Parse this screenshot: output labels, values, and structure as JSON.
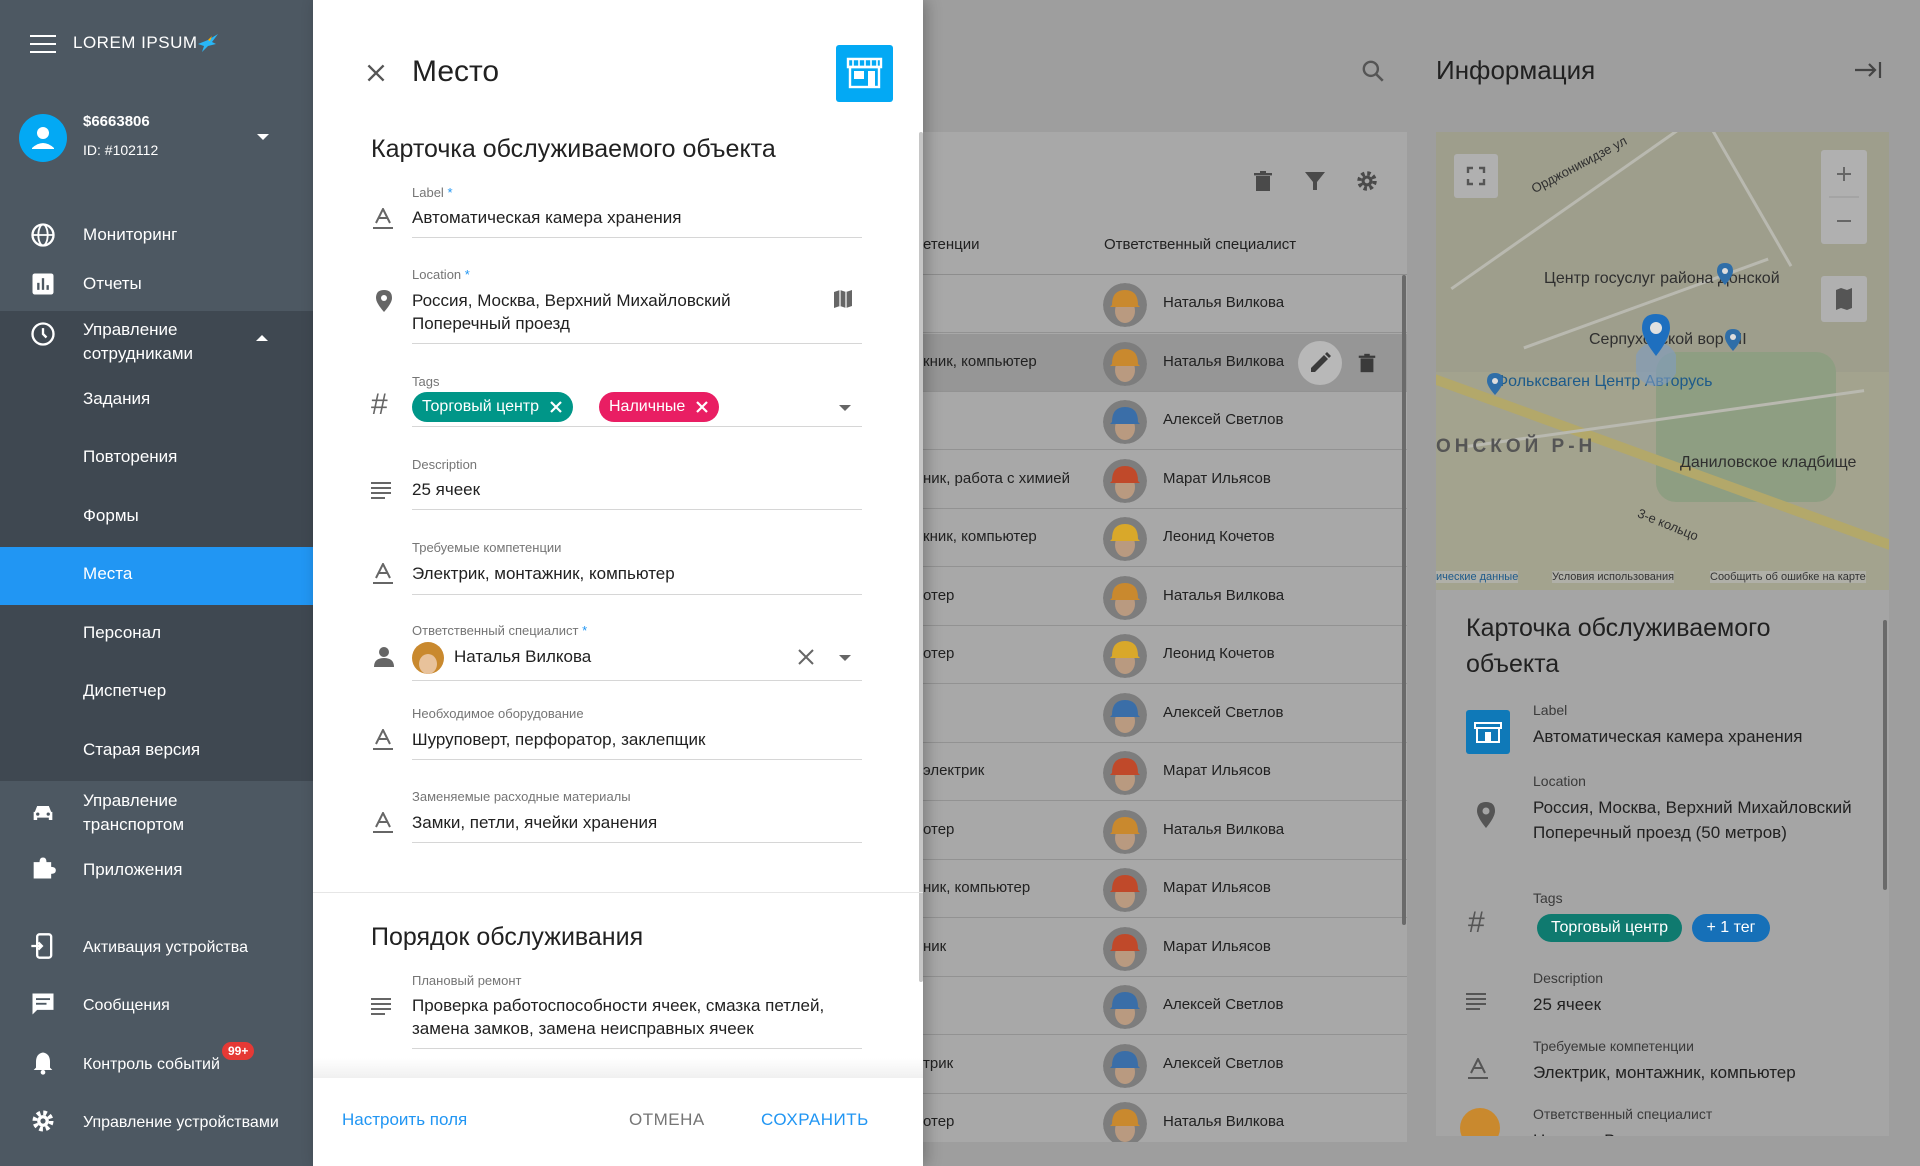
{
  "app": {
    "logo_text": "LOREM IPSUM",
    "account": {
      "name": "$6663806",
      "id": "ID: #102112"
    }
  },
  "sidebar": {
    "items": [
      {
        "label": "Мониторинг",
        "icon": "globe-icon"
      },
      {
        "label": "Отчеты",
        "icon": "chart-icon"
      },
      {
        "label": "Управление сотрудниками",
        "icon": "clock-icon"
      },
      {
        "label": "Управление транспортом",
        "icon": "car-icon"
      },
      {
        "label": "Приложения",
        "icon": "puzzle-icon"
      },
      {
        "label": "Активация устройства",
        "icon": "phone-add-icon"
      },
      {
        "label": "Сообщения",
        "icon": "message-icon"
      },
      {
        "label": "Контроль событий",
        "icon": "bell-icon",
        "badge": "99+"
      },
      {
        "label": "Управление устройствами",
        "icon": "gear-icon"
      }
    ],
    "sub_items": [
      "Задания",
      "Повторения",
      "Формы",
      "Места",
      "Персонал",
      "Диспетчер",
      "Старая версия"
    ],
    "active_sub": "Места"
  },
  "dialog": {
    "title": "Место",
    "section1_title": "Карточка обслуживаемого объекта",
    "fields": {
      "label": {
        "label": "Label",
        "value": "Автоматическая камера хранения"
      },
      "location": {
        "label": "Location",
        "value": "Россия, Москва, Верхний Михайловский Поперечный проезд"
      },
      "tags": {
        "label": "Tags",
        "chips": [
          "Торговый центр",
          "Наличные"
        ]
      },
      "description": {
        "label": "Description",
        "value": "25 ячеек"
      },
      "competencies": {
        "label": "Требуемые компетенции",
        "value": "Электрик, монтажник, компьютер"
      },
      "specialist": {
        "label": "Ответственный специалист",
        "value": "Наталья Вилкова"
      },
      "equipment": {
        "label": "Необходимое оборудование",
        "value": "Шуруповерт, перфоратор, заклепщик"
      },
      "materials": {
        "label": "Заменяемые расходные материалы",
        "value": "Замки, петли, ячейки хранения"
      }
    },
    "section2_title": "Порядок обслуживания",
    "repair": {
      "label": "Плановый ремонт",
      "value": "Проверка работоспособности ячеек, смазка петлей, замена замков, замена неисправных ячеек"
    },
    "footer": {
      "configure": "Настроить поля",
      "cancel": "ОТМЕНА",
      "save": "СОХРАНИТЬ"
    },
    "colors": {
      "accent": "#2196f3",
      "chip_teal": "#009688",
      "chip_pink": "#e91e63",
      "store_tile": "#03a9f4"
    }
  },
  "table": {
    "col_competencies": "етенции",
    "col_specialist": "Ответственный специалист",
    "rows": [
      {
        "comp": "",
        "name": "Наталья Вилкова",
        "helmet": "#c9892e"
      },
      {
        "comp": "кник, компьютер",
        "name": "Наталья Вилкова",
        "helmet": "#c9892e"
      },
      {
        "comp": "",
        "name": "Алексей Светлов",
        "helmet": "#3a6ea8"
      },
      {
        "comp": "ник, работа с химией",
        "name": "Марат Ильясов",
        "helmet": "#c0492a"
      },
      {
        "comp": "кник, компьютер",
        "name": "Леонид Кочетов",
        "helmet": "#d9a82a"
      },
      {
        "comp": "отер",
        "name": "Наталья Вилкова",
        "helmet": "#c9892e"
      },
      {
        "comp": "отер",
        "name": "Леонид Кочетов",
        "helmet": "#d9a82a"
      },
      {
        "comp": "",
        "name": "Алексей Светлов",
        "helmet": "#3a6ea8"
      },
      {
        "comp": "электрик",
        "name": "Марат Ильясов",
        "helmet": "#c0492a"
      },
      {
        "comp": "отер",
        "name": "Наталья Вилкова",
        "helmet": "#c9892e"
      },
      {
        "comp": "ник, компьютер",
        "name": "Марат Ильясов",
        "helmet": "#c0492a"
      },
      {
        "comp": "ник",
        "name": "Марат Ильясов",
        "helmet": "#c0492a"
      },
      {
        "comp": "",
        "name": "Алексей Светлов",
        "helmet": "#3a6ea8"
      },
      {
        "comp": "трик",
        "name": "Алексей Светлов",
        "helmet": "#3a6ea8"
      },
      {
        "comp": "отер",
        "name": "Наталья Вилкова",
        "helmet": "#c9892e"
      }
    ]
  },
  "info": {
    "title": "Информация",
    "map_labels": {
      "ordzh": "Орджоникидзе ул",
      "center": "Центр госуслуг района Донской",
      "serp": "Серпуховской вор - II",
      "vw": "Фольксваген Центр Авторусь",
      "district": "ОНСКОЙ Р-Н",
      "cemetery": "Даниловское кладбище",
      "ring": "3-е кольцо",
      "foot_data": "ические данные",
      "foot_terms": "Условия использования",
      "foot_report": "Сообщить об ошибке на карте"
    },
    "card_title": "Карточка обслуживаемого объекта",
    "label_label": "Label",
    "label_value": "Автоматическая камера хранения",
    "location_label": "Location",
    "location_value": "Россия, Москва, Верхний Михайловский Поперечный проезд (50 метров)",
    "tags_label": "Tags",
    "tag_chip": "Торговый центр",
    "tag_more": "+ 1 тег",
    "desc_label": "Description",
    "desc_value": "25 ячеек",
    "comp_label": "Требуемые компетенции",
    "comp_value": "Электрик, монтажник, компьютер",
    "spec_label": "Ответственный специалист",
    "spec_value": "Наталья Вилкова"
  }
}
